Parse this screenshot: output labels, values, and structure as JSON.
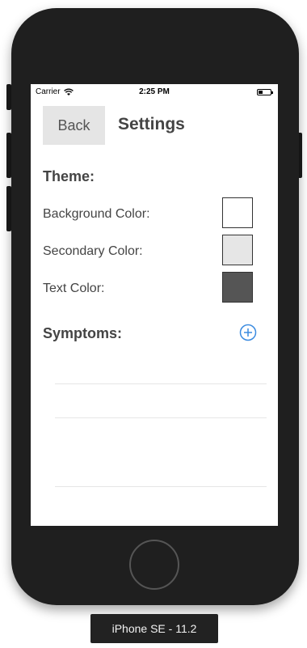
{
  "status_bar": {
    "carrier": "Carrier",
    "time": "2:25 PM"
  },
  "header": {
    "back_label": "Back",
    "title": "Settings"
  },
  "theme": {
    "title": "Theme:",
    "rows": [
      {
        "label": "Background Color:",
        "color": "#ffffff"
      },
      {
        "label": "Secondary Color:",
        "color": "#e6e6e6"
      },
      {
        "label": "Text Color:",
        "color": "#555555"
      }
    ]
  },
  "symptoms": {
    "title": "Symptoms:",
    "add_icon": "plus-circle-icon",
    "accent": "#3b8be0"
  },
  "device": {
    "label": "iPhone SE - 11.2"
  }
}
